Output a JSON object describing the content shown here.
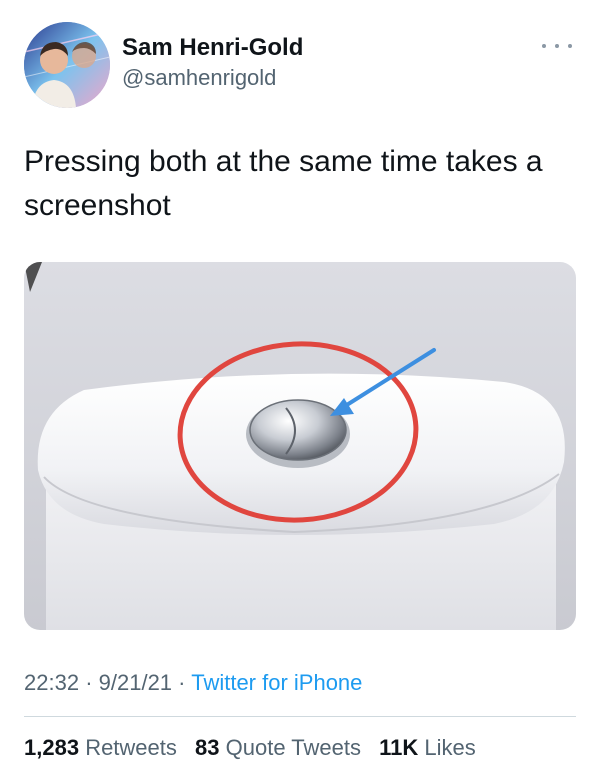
{
  "author": {
    "display_name": "Sam Henri-Gold",
    "handle": "@samhenrigold"
  },
  "more_icon": "more-horizontal-icon",
  "tweet": {
    "text": "Pressing both at the same time takes a screenshot"
  },
  "media": {
    "description_icon": "toilet-flush-button-photo",
    "annotation_colors": {
      "circle": "#e0463f",
      "arrow": "#3d8fe0"
    }
  },
  "meta": {
    "time": "22:32",
    "separator": "·",
    "date": "9/21/21",
    "source": "Twitter for iPhone"
  },
  "stats": {
    "retweets_count": "1,283",
    "retweets_label": "Retweets",
    "quotes_count": "83",
    "quotes_label": "Quote Tweets",
    "likes_count": "11K",
    "likes_label": "Likes"
  },
  "colors": {
    "link": "#1d9bf0",
    "secondary_text": "#536471",
    "primary_text": "#0f1419"
  }
}
